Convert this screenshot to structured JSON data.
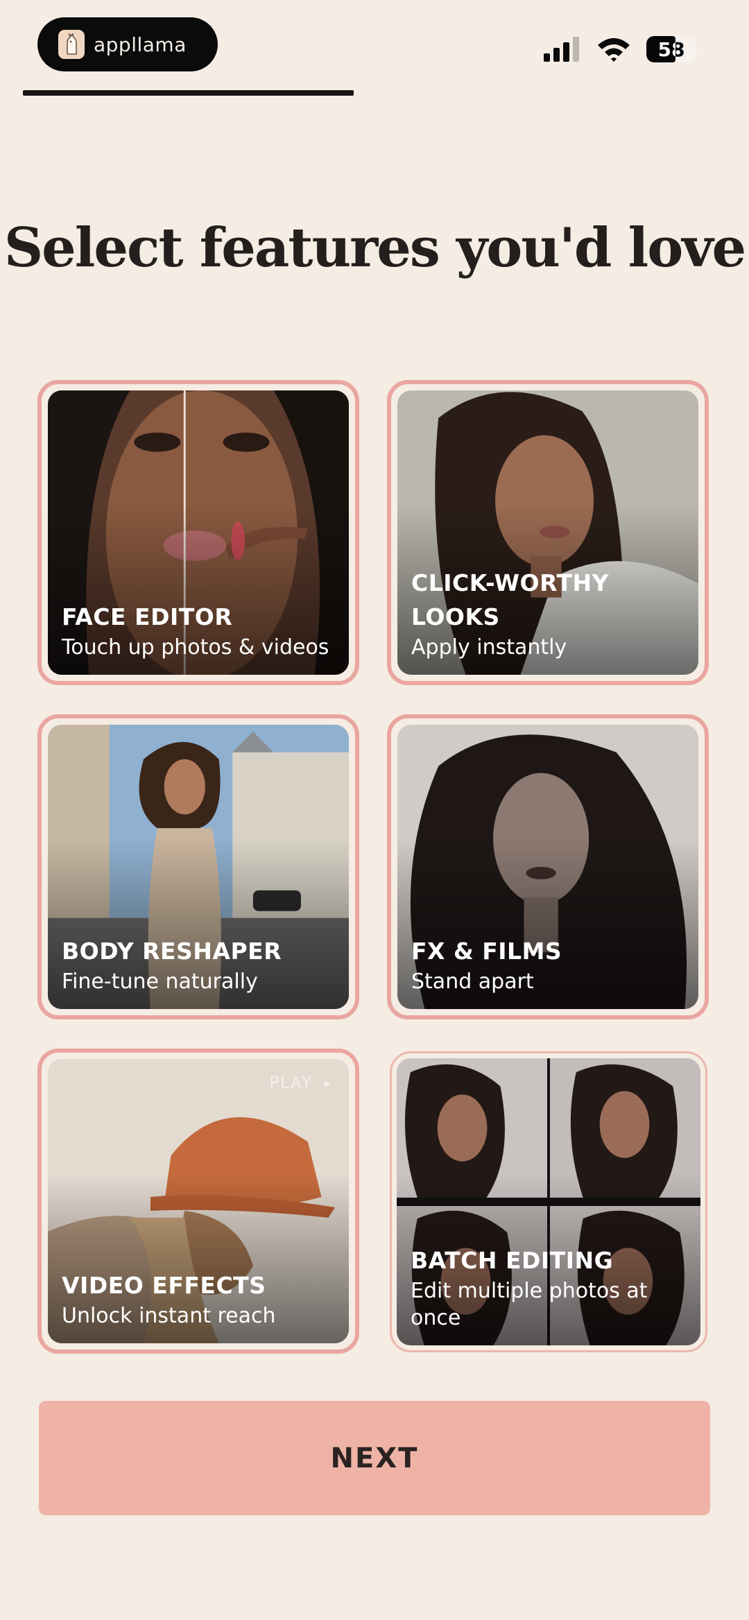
{
  "status_bar": {
    "app_name": "appllama",
    "app_icon": "llama-icon",
    "battery_level": "58",
    "battery_fraction": 0.58,
    "signal_icon": "cellular-signal-icon",
    "wifi_icon": "wifi-icon"
  },
  "progress": {
    "fraction": 0.47
  },
  "title": "Select features you'd love",
  "features": [
    {
      "title": "FACE EDITOR",
      "subtitle": "Touch up photos & videos",
      "selected": true
    },
    {
      "title": "CLICK-WORTHY LOOKS",
      "subtitle": "Apply instantly",
      "selected": true
    },
    {
      "title": "BODY RESHAPER",
      "subtitle": "Fine-tune naturally",
      "selected": true
    },
    {
      "title": "FX & FILMS",
      "subtitle": "Stand apart",
      "selected": true
    },
    {
      "title": "VIDEO EFFECTS",
      "subtitle": "Unlock instant reach",
      "selected": true,
      "overlay_label": "PLAY ▸"
    },
    {
      "title": "BATCH EDITING",
      "subtitle": "Edit multiple photos at once",
      "selected": false
    }
  ],
  "next_label": "NEXT",
  "colors": {
    "background": "#f5ece4",
    "selected_border": "#e9a6a0",
    "button": "#eeb3a6",
    "title_text": "#231f1c"
  }
}
